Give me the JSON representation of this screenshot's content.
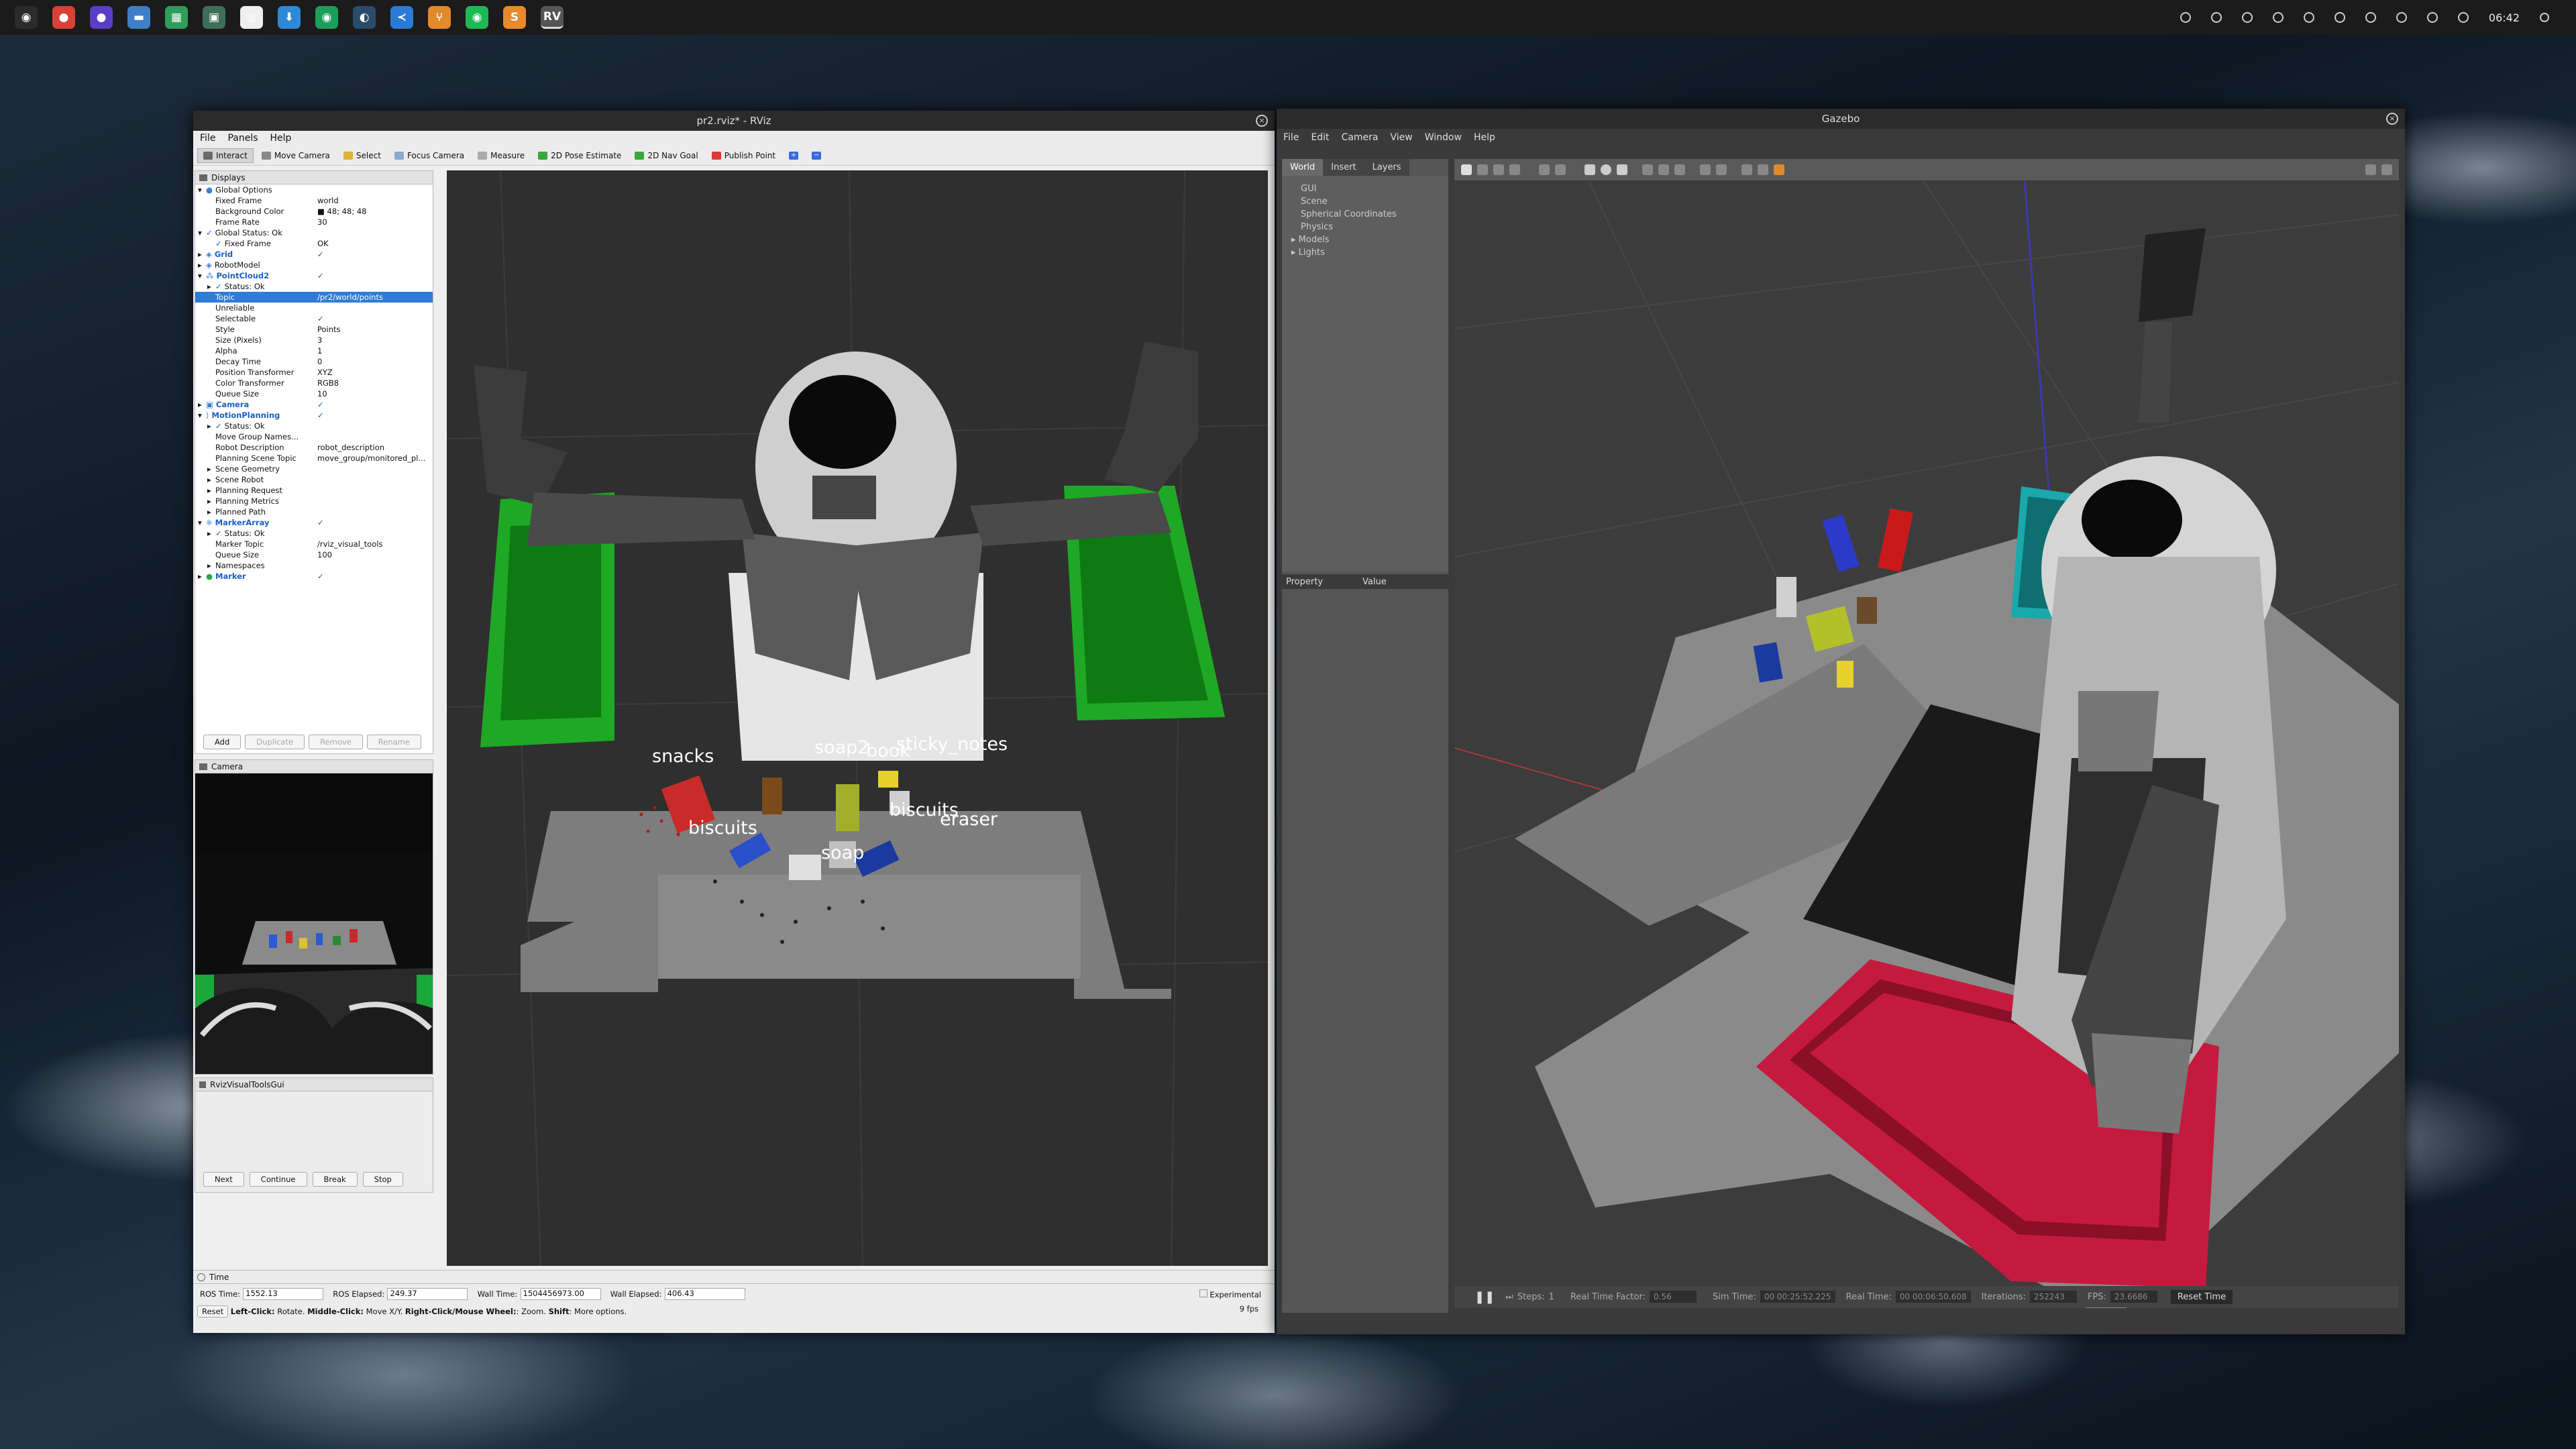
{
  "taskbar": {
    "apps": [
      {
        "name": "ubuntu-menu-icon",
        "color": "#2b2b2b",
        "glyph": "◉"
      },
      {
        "name": "chrome-icon",
        "color": "#d64236",
        "glyph": "●"
      },
      {
        "name": "firefox-icon",
        "color": "#5a3ec8",
        "glyph": "●"
      },
      {
        "name": "files-icon",
        "color": "#3e7fc8",
        "glyph": "▬"
      },
      {
        "name": "sheets-icon",
        "color": "#2e9e5a",
        "glyph": "▦"
      },
      {
        "name": "monitor-icon",
        "color": "#3e6e5a",
        "glyph": "▣"
      },
      {
        "name": "github-icon",
        "color": "#efefef",
        "glyph": "◎"
      },
      {
        "name": "download-icon",
        "color": "#2d89d6",
        "glyph": "⬇"
      },
      {
        "name": "spotify-alt-icon",
        "color": "#1d9e5a",
        "glyph": "◉"
      },
      {
        "name": "app-icon",
        "color": "#2b4b6b",
        "glyph": "◐"
      },
      {
        "name": "vscode-icon",
        "color": "#2b7bd6",
        "glyph": "≺"
      },
      {
        "name": "git-icon",
        "color": "#e08a2b",
        "glyph": "⑂"
      },
      {
        "name": "spotify-icon",
        "color": "#1db954",
        "glyph": "◉"
      },
      {
        "name": "sublime-icon",
        "color": "#e68a2b",
        "glyph": "S"
      },
      {
        "name": "rviz-icon",
        "color": "#555555",
        "glyph": "RV"
      }
    ],
    "clock": "06:42"
  },
  "rviz": {
    "title": "pr2.rviz* - RViz",
    "menu": [
      "File",
      "Panels",
      "Help"
    ],
    "toolbar": [
      {
        "label": "Interact",
        "color": "#6a6a6a",
        "active": true
      },
      {
        "label": "Move Camera",
        "color": "#888888"
      },
      {
        "label": "Select",
        "color": "#d9b23a"
      },
      {
        "label": "Focus Camera",
        "color": "#8aaad0"
      },
      {
        "label": "Measure",
        "color": "#aaaaaa"
      },
      {
        "label": "2D Pose Estimate",
        "color": "#3aa83a"
      },
      {
        "label": "2D Nav Goal",
        "color": "#3aa83a"
      },
      {
        "label": "Publish Point",
        "color": "#d93a3a"
      },
      {
        "label": "+",
        "color": "#3a6ad9"
      },
      {
        "label": "−",
        "color": "#3a6ad9"
      }
    ],
    "displays_title": "Displays",
    "tree": [
      {
        "i": 0,
        "k": "Global Options",
        "v": "",
        "exp": "▾",
        "icon": "●",
        "ic": "#3a7bd5"
      },
      {
        "i": 1,
        "k": "Fixed Frame",
        "v": "world"
      },
      {
        "i": 1,
        "k": "Background Color",
        "v": "■ 48; 48; 48"
      },
      {
        "i": 1,
        "k": "Frame Rate",
        "v": "30"
      },
      {
        "i": 0,
        "k": "Global Status: Ok",
        "v": "",
        "exp": "▾",
        "icon": "✓",
        "ic": "#1a5fbf"
      },
      {
        "i": 1,
        "k": "Fixed Frame",
        "v": "OK",
        "icon": "✓",
        "ic": "#1a5fbf"
      },
      {
        "i": 0,
        "k": "Grid",
        "v": "✓",
        "exp": "▸",
        "icon": "◈",
        "ic": "#3a7bd5",
        "blue": true
      },
      {
        "i": 0,
        "k": "RobotModel",
        "v": "",
        "exp": "▸",
        "icon": "◈",
        "ic": "#3a7bd5"
      },
      {
        "i": 0,
        "k": "PointCloud2",
        "v": "✓",
        "exp": "▾",
        "icon": "⁂",
        "ic": "#3a7bd5",
        "blue": true
      },
      {
        "i": 1,
        "k": "Status: Ok",
        "v": "",
        "exp": "▸",
        "icon": "✓",
        "ic": "#1a5fbf"
      },
      {
        "i": 1,
        "k": "Topic",
        "v": "/pr2/world/points",
        "sel": true
      },
      {
        "i": 1,
        "k": "Unreliable",
        "v": ""
      },
      {
        "i": 1,
        "k": "Selectable",
        "v": "✓"
      },
      {
        "i": 1,
        "k": "Style",
        "v": "Points"
      },
      {
        "i": 1,
        "k": "Size (Pixels)",
        "v": "3"
      },
      {
        "i": 1,
        "k": "Alpha",
        "v": "1"
      },
      {
        "i": 1,
        "k": "Decay Time",
        "v": "0"
      },
      {
        "i": 1,
        "k": "Position Transformer",
        "v": "XYZ"
      },
      {
        "i": 1,
        "k": "Color Transformer",
        "v": "RGB8"
      },
      {
        "i": 1,
        "k": "Queue Size",
        "v": "10"
      },
      {
        "i": 0,
        "k": "Camera",
        "v": "✓",
        "exp": "▸",
        "icon": "▣",
        "ic": "#3a7bd5",
        "blue": true
      },
      {
        "i": 0,
        "k": "MotionPlanning",
        "v": "✓",
        "exp": "▾",
        "icon": "⟩",
        "ic": "#3a7bd5",
        "blue": true
      },
      {
        "i": 1,
        "k": "Status: Ok",
        "v": "",
        "exp": "▸",
        "icon": "✓",
        "ic": "#1a5fbf"
      },
      {
        "i": 1,
        "k": "Move Group Names...",
        "v": ""
      },
      {
        "i": 1,
        "k": "Robot Description",
        "v": "robot_description"
      },
      {
        "i": 1,
        "k": "Planning Scene Topic",
        "v": "move_group/monitored_pl..."
      },
      {
        "i": 1,
        "k": "Scene Geometry",
        "v": "",
        "exp": "▸"
      },
      {
        "i": 1,
        "k": "Scene Robot",
        "v": "",
        "exp": "▸"
      },
      {
        "i": 1,
        "k": "Planning Request",
        "v": "",
        "exp": "▸"
      },
      {
        "i": 1,
        "k": "Planning Metrics",
        "v": "",
        "exp": "▸"
      },
      {
        "i": 1,
        "k": "Planned Path",
        "v": "",
        "exp": "▸"
      },
      {
        "i": 0,
        "k": "MarkerArray",
        "v": "✓",
        "exp": "▾",
        "icon": "⁜",
        "ic": "#3a7bd5",
        "blue": true
      },
      {
        "i": 1,
        "k": "Status: Ok",
        "v": "",
        "exp": "▸",
        "icon": "✓",
        "ic": "#1a5fbf"
      },
      {
        "i": 1,
        "k": "Marker Topic",
        "v": "/rviz_visual_tools"
      },
      {
        "i": 1,
        "k": "Queue Size",
        "v": "100"
      },
      {
        "i": 1,
        "k": "Namespaces",
        "v": "",
        "exp": "▸"
      },
      {
        "i": 0,
        "k": "Marker",
        "v": "✓",
        "exp": "▸",
        "icon": "●",
        "ic": "#2aa84a",
        "blue": true
      }
    ],
    "tree_buttons": {
      "add": "Add",
      "duplicate": "Duplicate",
      "remove": "Remove",
      "rename": "Rename"
    },
    "camera_title": "Camera",
    "visual_title": "RvizVisualToolsGui",
    "visual_buttons": {
      "next": "Next",
      "continue": "Continue",
      "break": "Break",
      "stop": "Stop"
    },
    "labels3d": [
      "snacks",
      "soap2",
      "book",
      "sticky_notes",
      "biscuits",
      "eraser",
      "biscuits",
      "soap"
    ],
    "time": {
      "title": "Time",
      "ros_time_label": "ROS Time:",
      "ros_time": "1552.13",
      "ros_elapsed_label": "ROS Elapsed:",
      "ros_elapsed": "249.37",
      "wall_time_label": "Wall Time:",
      "wall_time": "1504456973.00",
      "wall_elapsed_label": "Wall Elapsed:",
      "wall_elapsed": "406.43",
      "experimental": "Experimental",
      "reset": "Reset",
      "hint_a": "Left-Click:",
      "hint_b": " Rotate. ",
      "hint_c": "Middle-Click:",
      "hint_d": " Move X/Y. ",
      "hint_e": "Right-Click/Mouse Wheel:",
      "hint_f": ": Zoom. ",
      "hint_g": "Shift",
      "hint_h": ": More options.",
      "fps": "9 fps"
    }
  },
  "gazebo": {
    "title": "Gazebo",
    "menu": [
      "File",
      "Edit",
      "Camera",
      "View",
      "Window",
      "Help"
    ],
    "tabs": [
      "World",
      "Insert",
      "Layers"
    ],
    "world_items": [
      "GUI",
      "Scene",
      "Spherical Coordinates",
      "Physics",
      "Models",
      "Lights"
    ],
    "prop_header": [
      "Property",
      "Value"
    ],
    "status": {
      "steps_label": "Steps:",
      "steps": "1",
      "rtf_label": "Real Time Factor:",
      "rtf": "0.56",
      "sim_label": "Sim Time:",
      "sim": "00 00:25:52.225",
      "real_label": "Real Time:",
      "real": "00 00:06:50.608",
      "iter_label": "Iterations:",
      "iter": "252243",
      "fps_label": "FPS:",
      "fps": "23.6686",
      "reset": "Reset Time"
    }
  }
}
